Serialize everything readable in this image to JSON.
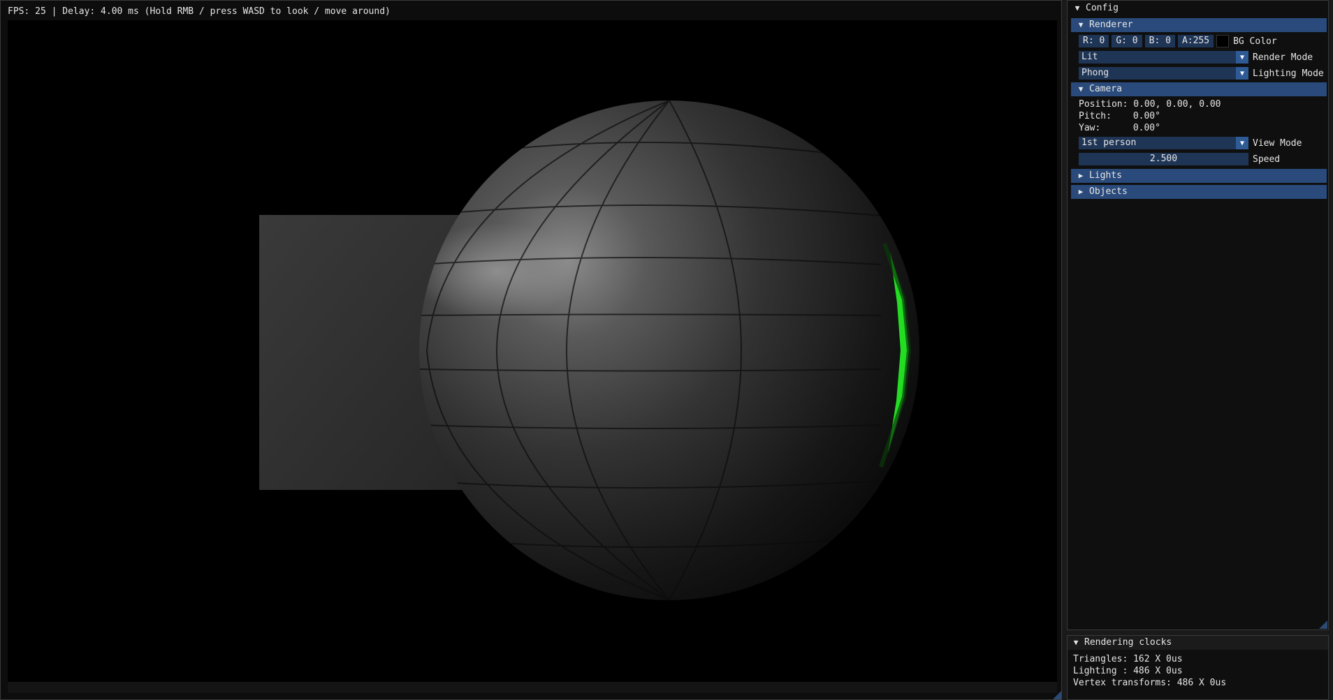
{
  "viewport": {
    "status": "FPS: 25 | Delay: 4.00 ms (Hold RMB / press WASD to look / move around)"
  },
  "config": {
    "title": "Config",
    "renderer": {
      "header": "Renderer",
      "bg": {
        "r": "R:  0",
        "g": "G:  0",
        "b": "B:  0",
        "a": "A:255",
        "swatch_color": "#000000",
        "label": "BG Color"
      },
      "render_mode": {
        "value": "Lit",
        "label": "Render Mode"
      },
      "lighting_mode": {
        "value": "Phong",
        "label": "Lighting Mode"
      }
    },
    "camera": {
      "header": "Camera",
      "position": {
        "key": "Position:",
        "value": "0.00, 0.00, 0.00"
      },
      "pitch": {
        "key": "Pitch:",
        "value": "0.00°"
      },
      "yaw": {
        "key": "Yaw:",
        "value": "0.00°"
      },
      "view_mode": {
        "value": "1st person",
        "label": "View Mode"
      },
      "speed": {
        "value": "2.500",
        "label": "Speed"
      }
    },
    "lights": {
      "header": "Lights"
    },
    "objects": {
      "header": "Objects"
    }
  },
  "clocks": {
    "title": "Rendering clocks",
    "triangles": "Triangles: 162 X 0us",
    "lighting": "Lighting : 486 X 0us",
    "vertex": "Vertex transforms: 486 X 0us"
  },
  "colors": {
    "header_blue": "#294a7a",
    "field_blue": "#1f3556",
    "light_red": "#ff1a1a",
    "light_green": "#22dd22"
  },
  "icons": {
    "expanded": "triangle-down-icon",
    "collapsed": "triangle-right-icon",
    "combo": "combo-arrow-icon"
  }
}
